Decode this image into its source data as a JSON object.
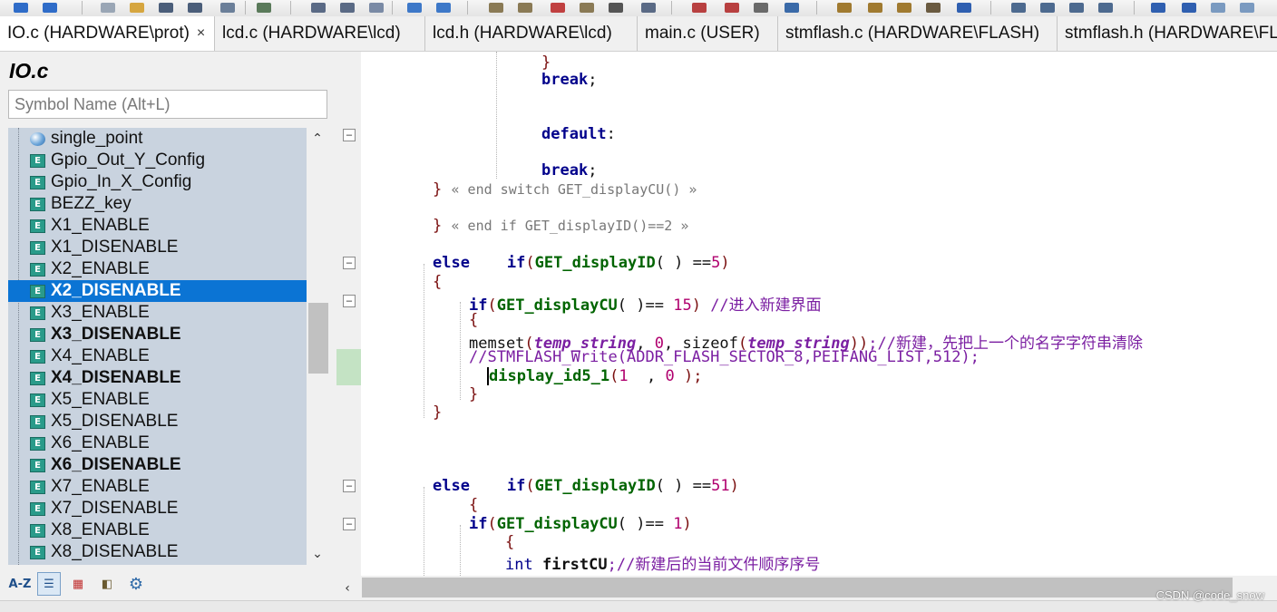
{
  "toolbar": {
    "icons": [
      "back-arrow-icon",
      "forward-arrow-icon",
      "new-file-icon",
      "open-folder-icon",
      "save-icon",
      "save-all-icon",
      "print-icon",
      "find-icon",
      "replace-icon",
      "undo-icon",
      "redo-icon",
      "bookmark-icon",
      "build-icon",
      "rebuild-icon",
      "download-icon",
      "debug-icon",
      "options-icon",
      "window-icon"
    ]
  },
  "tabs": [
    {
      "label": "IO.c (HARDWARE\\prot)",
      "active": true,
      "close": "×"
    },
    {
      "label": "lcd.c (HARDWARE\\lcd)"
    },
    {
      "label": "lcd.h (HARDWARE\\lcd)"
    },
    {
      "label": "main.c (USER)"
    },
    {
      "label": "stmflash.c (HARDWARE\\FLASH)"
    },
    {
      "label": "stmflash.h (HARDWARE\\FLASH)"
    }
  ],
  "symbols_panel": {
    "title": "IO.c",
    "search_placeholder": "Symbol Name (Alt+L)",
    "items": [
      {
        "label": "single_point",
        "icon": "variable-ball-icon"
      },
      {
        "label": "Gpio_Out_Y_Config",
        "icon": "function-icon"
      },
      {
        "label": "Gpio_In_X_Config",
        "icon": "function-icon"
      },
      {
        "label": "BEZZ_key",
        "icon": "function-icon"
      },
      {
        "label": "X1_ENABLE",
        "icon": "function-icon"
      },
      {
        "label": "X1_DISENABLE",
        "icon": "function-icon"
      },
      {
        "label": "X2_ENABLE",
        "icon": "function-icon"
      },
      {
        "label": "X2_DISENABLE",
        "icon": "function-icon",
        "selected": true
      },
      {
        "label": "X3_ENABLE",
        "icon": "function-icon"
      },
      {
        "label": "X3_DISENABLE",
        "icon": "function-icon",
        "bold": true
      },
      {
        "label": "X4_ENABLE",
        "icon": "function-icon"
      },
      {
        "label": "X4_DISENABLE",
        "icon": "function-icon",
        "bold": true
      },
      {
        "label": "X5_ENABLE",
        "icon": "function-icon"
      },
      {
        "label": "X5_DISENABLE",
        "icon": "function-icon"
      },
      {
        "label": "X6_ENABLE",
        "icon": "function-icon"
      },
      {
        "label": "X6_DISENABLE",
        "icon": "function-icon",
        "bold": true
      },
      {
        "label": "X7_ENABLE",
        "icon": "function-icon"
      },
      {
        "label": "X7_DISENABLE",
        "icon": "function-icon"
      },
      {
        "label": "X8_ENABLE",
        "icon": "function-icon"
      },
      {
        "label": "X8_DISENABLE",
        "icon": "function-icon"
      }
    ],
    "icon_letter": "E",
    "bottom_buttons": [
      {
        "label": "A-Z",
        "icon": "sort-az-icon"
      },
      {
        "label": "",
        "icon": "list-view-icon"
      },
      {
        "label": "",
        "icon": "category-icon"
      },
      {
        "label": "",
        "icon": "book-icon"
      },
      {
        "label": "",
        "icon": "gear-icon"
      }
    ]
  },
  "code": {
    "l1": {
      "text": "}"
    },
    "l2": {
      "kw": "break",
      "semi": ";"
    },
    "l3": {
      "kw": "default",
      "colon": ":"
    },
    "l4": {
      "kw": "break",
      "semi": ";"
    },
    "l5": {
      "brace": "}",
      "note": "« end switch GET_displayCU() »"
    },
    "l6": {
      "brace": "}",
      "note": "« end if GET_displayID()==2 »"
    },
    "l7": {
      "else": "else",
      "if": "if",
      "p1": "(",
      "fn": "GET_displayID",
      "args": "( ) ==",
      "num": "5",
      "p2": ")"
    },
    "l8": {
      "text": "{"
    },
    "l9": {
      "if": "if",
      "p1": "(",
      "fn": "GET_displayCU",
      "args": "( )== ",
      "num": "15",
      "p2": ")",
      "comment": " //进入新建界面"
    },
    "l10": {
      "text": "{"
    },
    "l11": {
      "fn": "memset",
      "p1": "(",
      "var1": "temp_string",
      "mid": ", ",
      "num": "0",
      "mid2": ", ",
      "fn2": "sizeof",
      "p2": "(",
      "var2": "temp_string",
      "p3": "))",
      "comment": ";//新建，先把上一个的名字字符串清除"
    },
    "l12": {
      "comment": "//STMFLASH_Write(ADDR_FLASH_SECTOR_8,PEIFANG_LIST,512);"
    },
    "l13": {
      "fn": "display_id5_1",
      "p1": "(",
      "num1": "1",
      "mid": "  , ",
      "num2": "0",
      "p2": " );"
    },
    "l14": {
      "text": "}"
    },
    "l15": {
      "text": "}"
    },
    "l16": {
      "else": "else",
      "if": "if",
      "p1": "(",
      "fn": "GET_displayID",
      "args": "( ) ==",
      "num": "51",
      "p2": ")"
    },
    "l17": {
      "text": "{"
    },
    "l18": {
      "if": "if",
      "p1": "(",
      "fn": "GET_displayCU",
      "args": "( )== ",
      "num": "1",
      "p2": ")"
    },
    "l19": {
      "text": "{"
    },
    "l20": {
      "kw": "int",
      "fn": "firstCU",
      "comment": ";//新建后的当前文件顺序序号"
    }
  },
  "watermark": "CSDN @code_snow",
  "colors": {
    "selection": "#0b74d4",
    "keyword": "#00008b",
    "function": "#006400",
    "number": "#b0006e",
    "comment": "#7b1fa2",
    "symbol_list_bg": "#c9d3df"
  }
}
